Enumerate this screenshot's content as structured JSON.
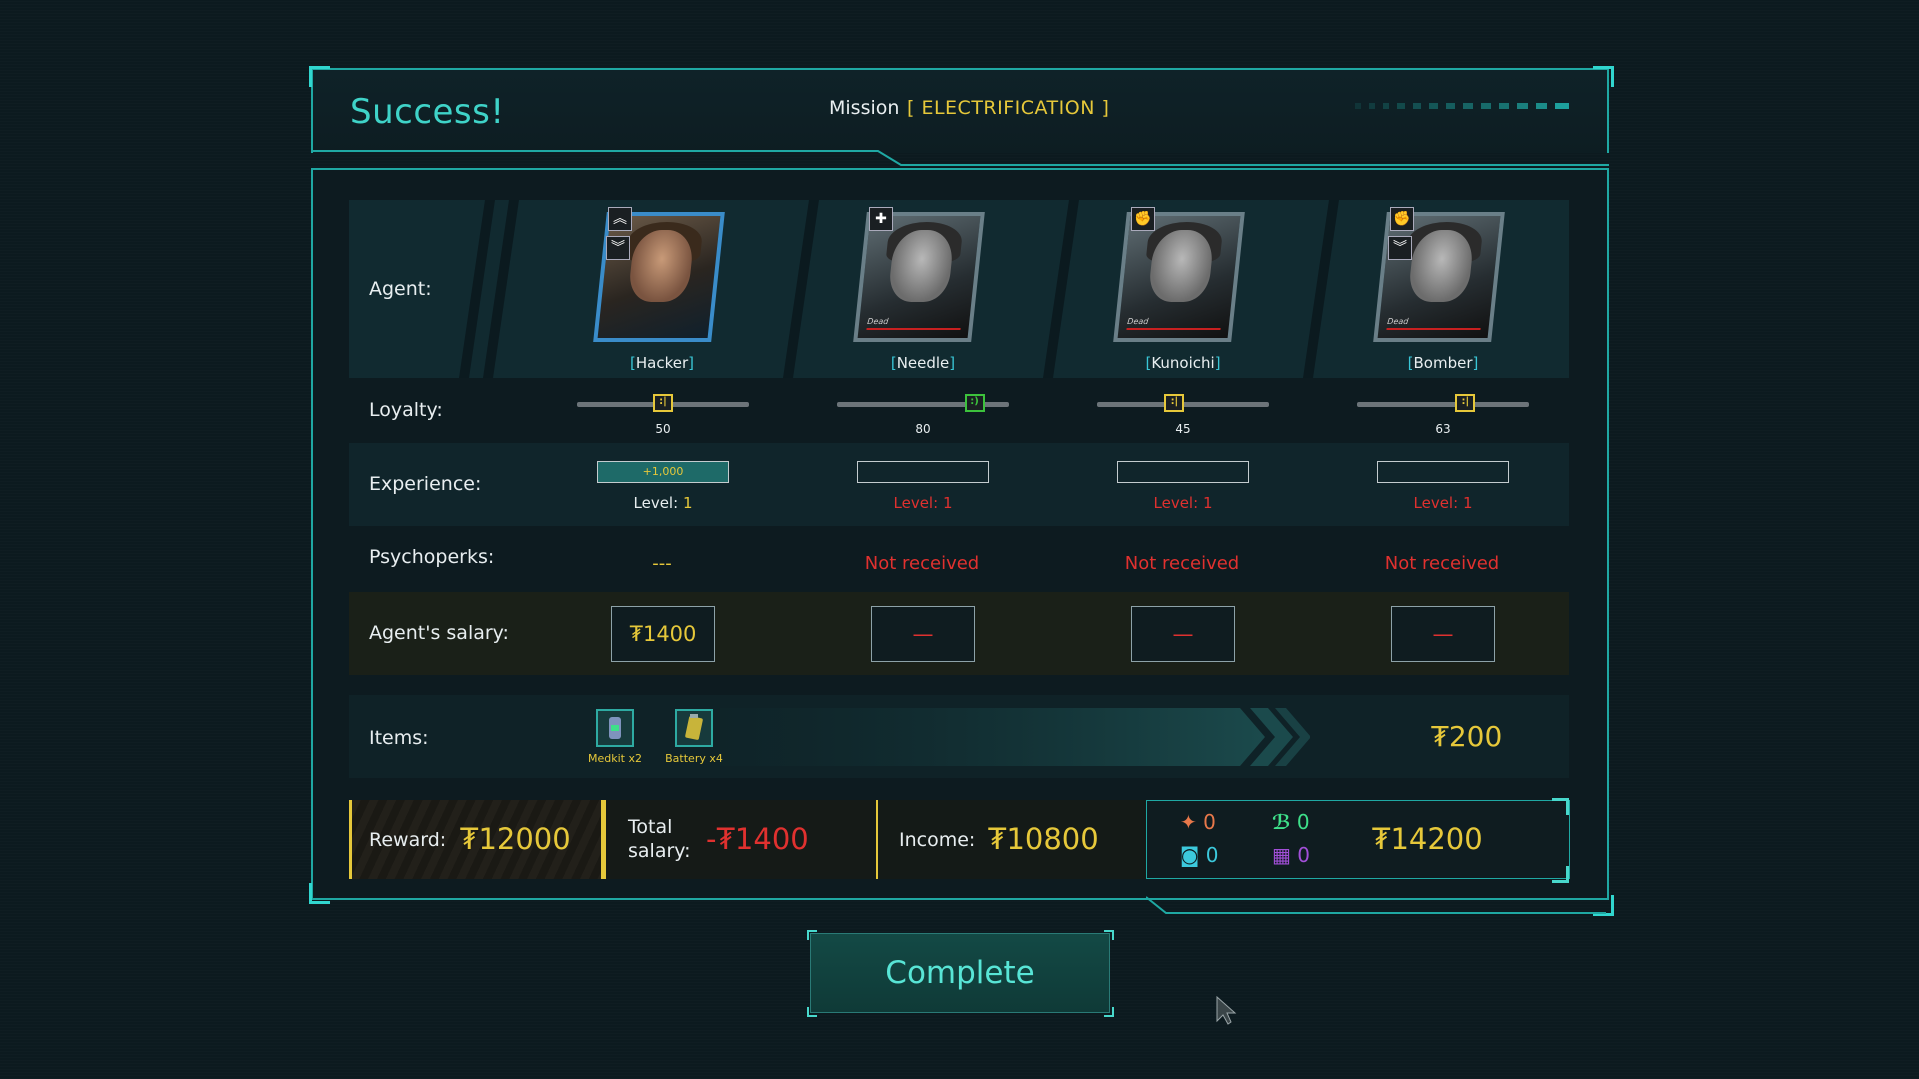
{
  "header": {
    "title": "Success!",
    "mission_label": "Mission",
    "mission_name": "[ ELECTRIFICATION ]"
  },
  "rows": {
    "agent": "Agent:",
    "loyalty": "Loyalty:",
    "experience": "Experience:",
    "psychoperks": "Psychoperks:",
    "salary": "Agent's salary:",
    "items": "Items:"
  },
  "agents": [
    {
      "name": "Hacker",
      "loyalty": 50,
      "loyalty_fraction": 0.5,
      "mood_color": "#e6c83a",
      "xp_gain": "+1,000",
      "level_label": "Level:",
      "level": "1",
      "level_color": "#e8eef0",
      "psychoperks": "---",
      "salary": "₮1400",
      "dead": false,
      "dead_label": ""
    },
    {
      "name": "Needle",
      "loyalty": 80,
      "loyalty_fraction": 0.8,
      "mood_color": "#3cc23c",
      "xp_gain": "",
      "level_label": "Level:",
      "level": "1",
      "level_color": "#e0312f",
      "psychoperks": "Not received",
      "salary": "—",
      "dead": true,
      "dead_label": "Dead"
    },
    {
      "name": "Kunoichi",
      "loyalty": 45,
      "loyalty_fraction": 0.45,
      "mood_color": "#e6c83a",
      "xp_gain": "",
      "level_label": "Level:",
      "level": "1",
      "level_color": "#e0312f",
      "psychoperks": "Not received",
      "salary": "—",
      "dead": true,
      "dead_label": "Dead"
    },
    {
      "name": "Bomber",
      "loyalty": 63,
      "loyalty_fraction": 0.63,
      "mood_color": "#e6c83a",
      "xp_gain": "",
      "level_label": "Level:",
      "level": "1",
      "level_color": "#e0312f",
      "psychoperks": "Not received",
      "salary": "—",
      "dead": true,
      "dead_label": "Dead"
    }
  ],
  "items": [
    {
      "icon": "medkit-icon",
      "label": "Medkit x2"
    },
    {
      "icon": "battery-icon",
      "label": "Battery x4"
    }
  ],
  "items_value": "₮200",
  "summary": {
    "reward_label": "Reward:",
    "reward_value": "₮12000",
    "total_salary_label_1": "Total",
    "total_salary_label_2": "salary:",
    "total_salary_value": "-₮1400",
    "income_label": "Income:",
    "income_value": "₮10800",
    "resources": [
      {
        "icon": "agent-figure-icon",
        "value": "0",
        "color": "#e8784a"
      },
      {
        "icon": "biotech-icon",
        "value": "0",
        "color": "#3ee08a"
      },
      {
        "icon": "camera-icon",
        "value": "0",
        "color": "#3cc9dc"
      },
      {
        "icon": "chip-icon",
        "value": "0",
        "color": "#a24fd8"
      }
    ],
    "total_value": "₮14200"
  },
  "complete_button": "Complete",
  "colors": {
    "accent": "#31d6cf",
    "gold": "#e6c83a",
    "red": "#e0312f"
  }
}
